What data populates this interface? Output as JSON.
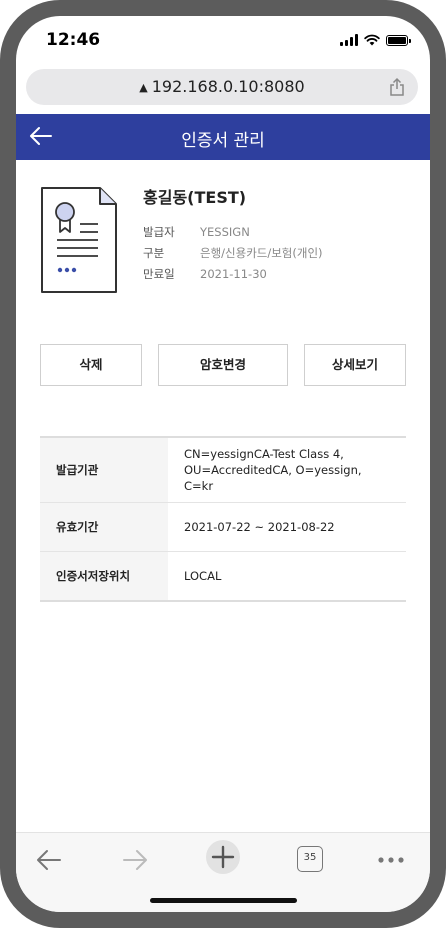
{
  "status_bar": {
    "time": "12:46"
  },
  "browser": {
    "url": "192.168.0.10:8080",
    "lock_glyph": "▲"
  },
  "app_bar": {
    "title": "인증서 관리"
  },
  "certificate": {
    "name": "홍길동(TEST)",
    "meta": [
      {
        "label": "발급자",
        "value": "YESSIGN"
      },
      {
        "label": "구분",
        "value": "은행/신용카드/보험(개인)"
      },
      {
        "label": "만료일",
        "value": "2021-11-30"
      }
    ]
  },
  "actions": {
    "delete_label": "삭제",
    "change_password_label": "암호변경",
    "details_label": "상세보기"
  },
  "info_table": {
    "rows": [
      {
        "label": "발급기관",
        "value": "CN=yessignCA-Test Class 4, OU=AccreditedCA, O=yessign, C=kr"
      },
      {
        "label": "유효기간",
        "value": "2021-07-22 ~ 2021-08-22"
      },
      {
        "label": "인증서저장위치",
        "value": "LOCAL"
      }
    ]
  },
  "bottom_toolbar": {
    "tab_count": "35"
  },
  "colors": {
    "app_bar": "#2e3f9e",
    "frame": "#5c5c5c"
  }
}
